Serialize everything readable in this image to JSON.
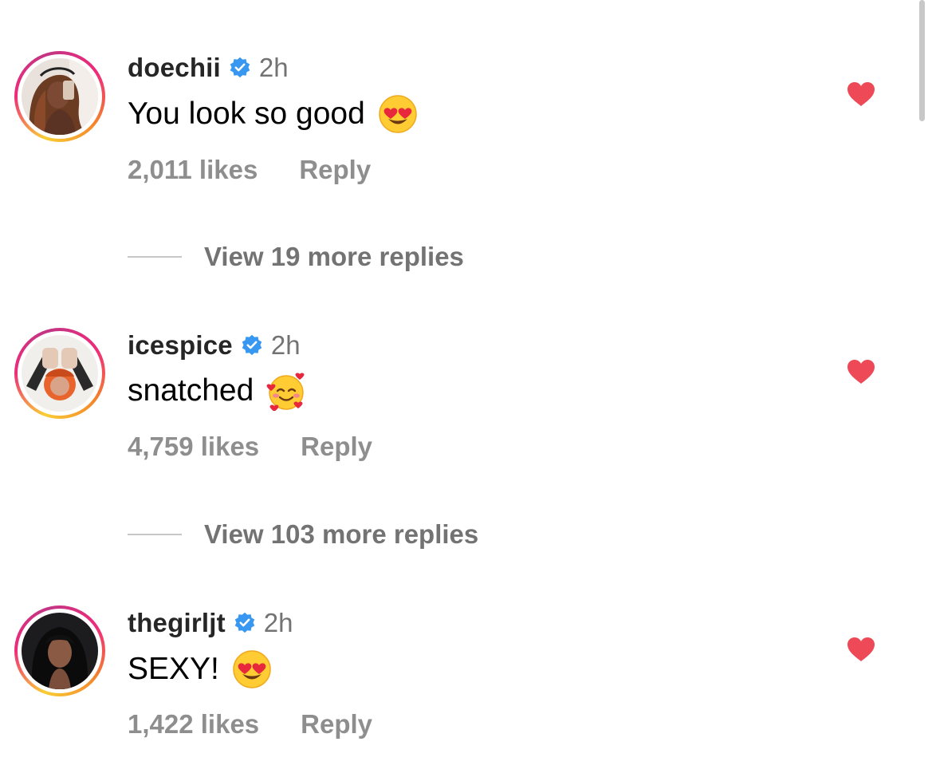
{
  "comments": [
    {
      "username": "doechii",
      "time": "2h",
      "text": "You look so good",
      "emoji": "heart-eyes",
      "likes": "2,011 likes",
      "reply": "Reply",
      "liked": true,
      "view_more": "View 19 more replies"
    },
    {
      "username": "icespice",
      "time": "2h",
      "text": "snatched",
      "emoji": "smiling-face-with-hearts",
      "likes": "4,759 likes",
      "reply": "Reply",
      "liked": true,
      "view_more": "View 103 more replies"
    },
    {
      "username": "thegirljt",
      "time": "2h",
      "text": "SEXY!",
      "emoji": "heart-eyes",
      "likes": "1,422 likes",
      "reply": "Reply",
      "liked": true
    }
  ],
  "icons": {
    "verified": "verified-badge-icon",
    "like": "heart-icon"
  },
  "colors": {
    "verified": "#3897f0",
    "heart": "#ed4956",
    "muted_text": "#8e8e8e",
    "username": "#262626"
  }
}
